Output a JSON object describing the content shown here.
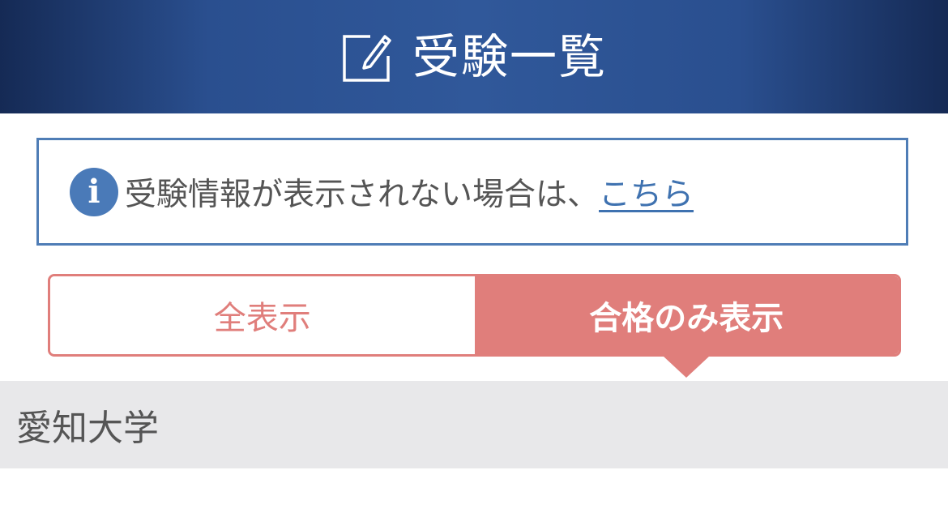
{
  "header": {
    "icon": "edit-icon",
    "title": "受験一覧"
  },
  "notice": {
    "icon": "info-icon",
    "icon_glyph": "i",
    "text": "受験情報が表示されない場合は、",
    "link_label": "こちら"
  },
  "filter": {
    "options": [
      {
        "label": "全表示",
        "selected": false
      },
      {
        "label": "合格のみ表示",
        "selected": true
      }
    ]
  },
  "sections": [
    {
      "title": "愛知大学"
    }
  ],
  "colors": {
    "header_bg": "#2a4f8f",
    "accent_blue": "#4f7db6",
    "accent_pink": "#e07e7b",
    "section_bg": "#e8e8ea"
  }
}
